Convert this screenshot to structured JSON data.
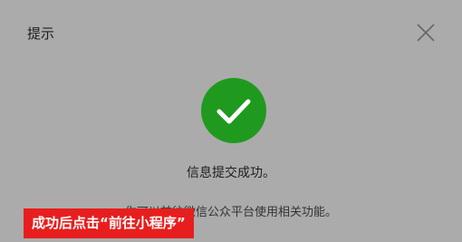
{
  "dialog": {
    "title": "提示",
    "message": "信息提交成功。",
    "sub_message": "你可以前往微信公众平台使用相关功能。"
  },
  "icons": {
    "close": "close-icon",
    "success": "checkmark-circle-icon"
  },
  "annotation": {
    "text": "成功后点击“前往小程序”"
  },
  "colors": {
    "overlay_background": "#ababab",
    "success_green": "#1f9a1f",
    "annotation_red": "#e81e1e"
  }
}
